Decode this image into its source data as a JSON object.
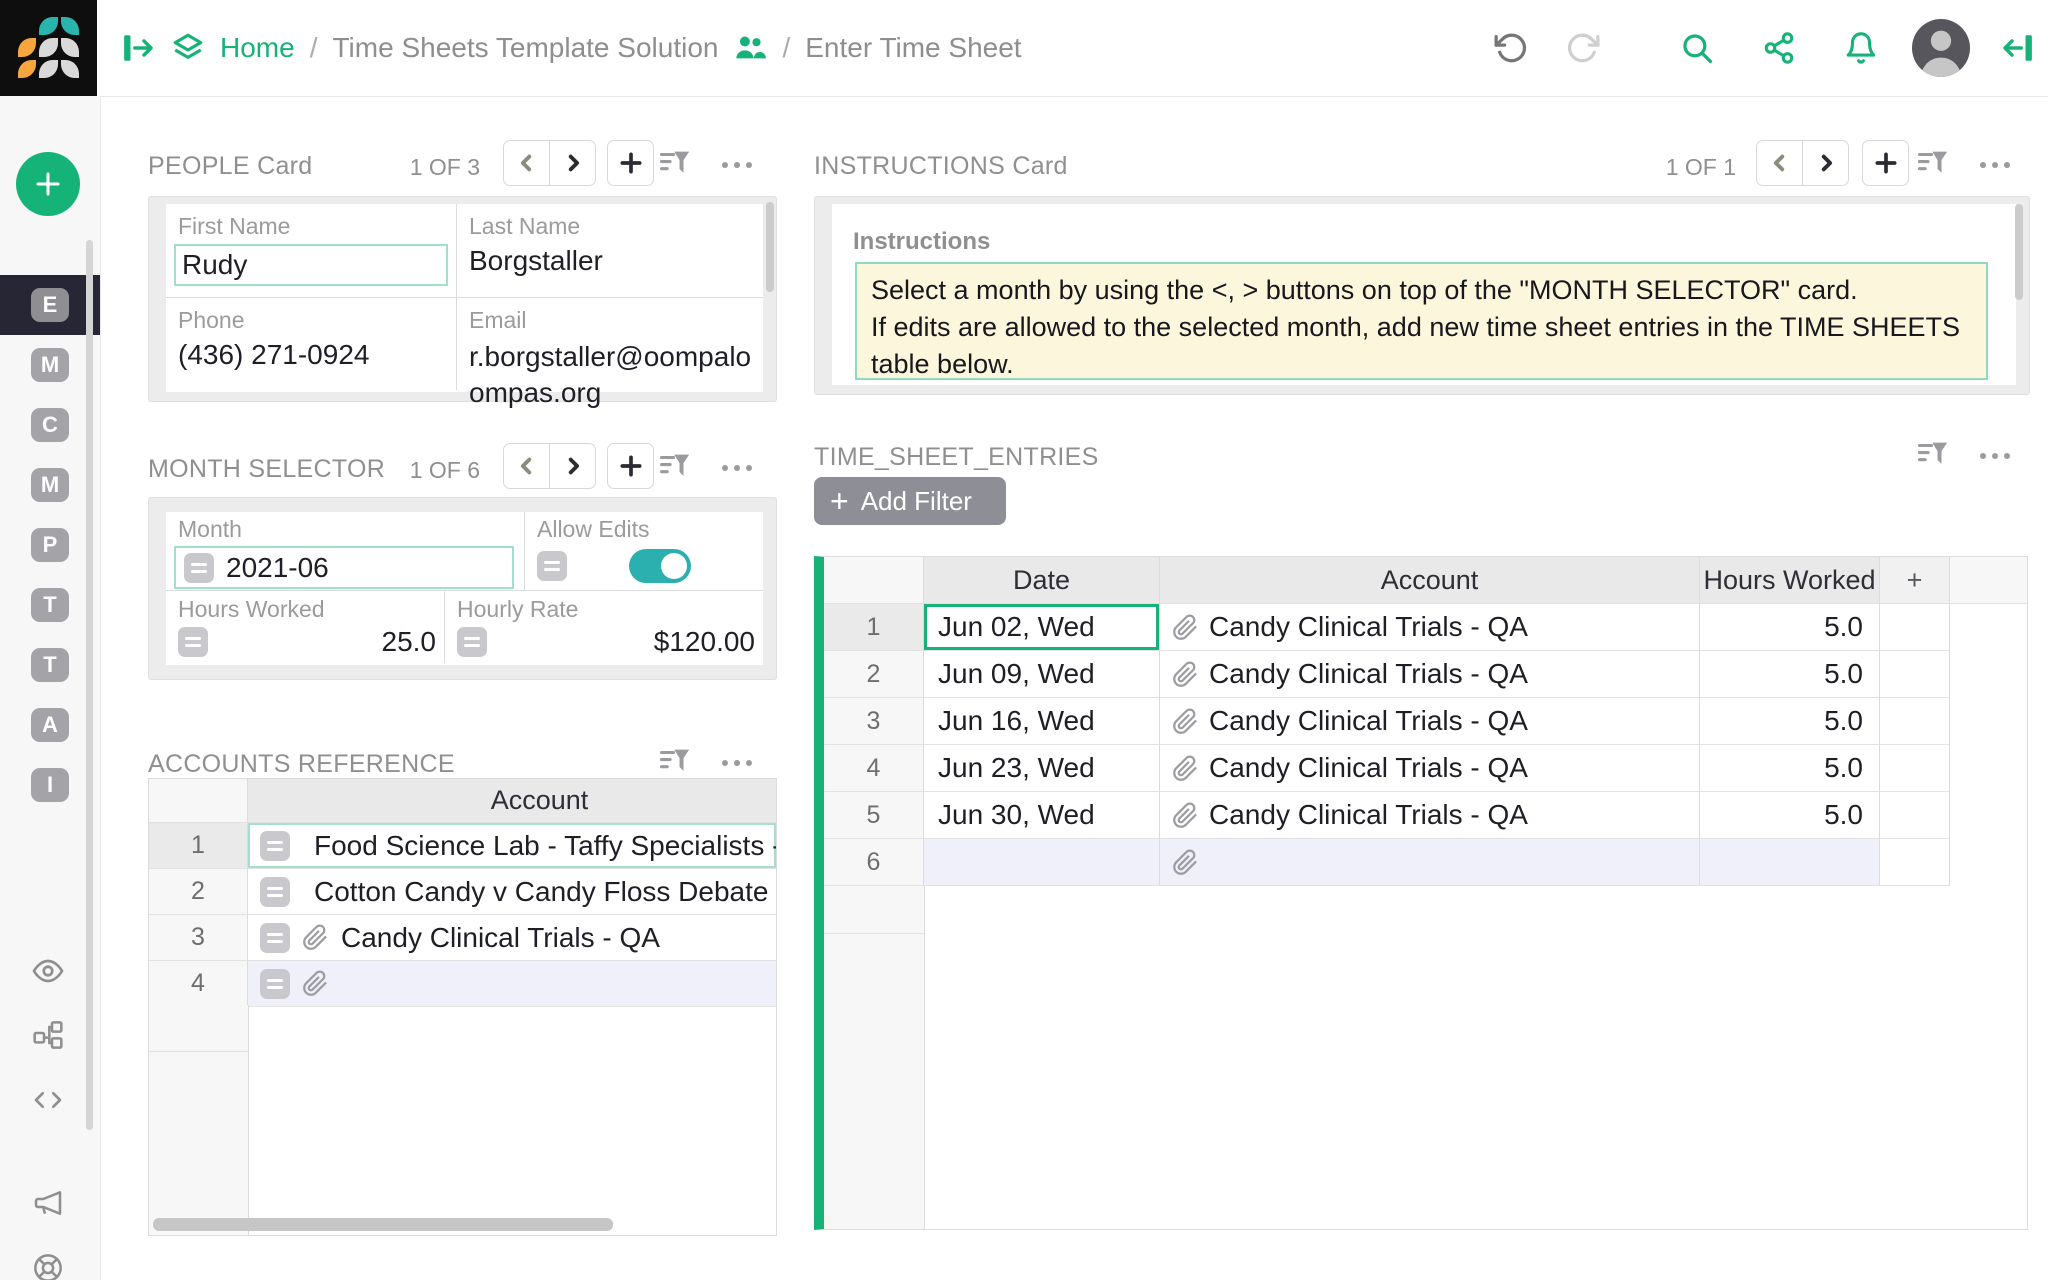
{
  "topbar": {
    "breadcrumb": {
      "home": "Home",
      "sep1": "/",
      "workspace": "Time Sheets Template Solution",
      "sep2": "/",
      "page": "Enter Time Sheet"
    }
  },
  "sidebar": {
    "pages": [
      "E",
      "M",
      "C",
      "M",
      "P",
      "T",
      "T",
      "A",
      "I"
    ]
  },
  "people_card": {
    "title": "PEOPLE Card",
    "count": "1 OF 3",
    "fields": {
      "first_name": {
        "label": "First Name",
        "value": "Rudy"
      },
      "last_name": {
        "label": "Last Name",
        "value": "Borgstaller"
      },
      "phone": {
        "label": "Phone",
        "value": "(436) 271-0924"
      },
      "email": {
        "label": "Email",
        "value": "r.borgstaller@oompaloompas.org"
      }
    }
  },
  "month_selector": {
    "title": "MONTH SELECTOR",
    "count": "1 OF 6",
    "month": {
      "label": "Month",
      "value": "2021-06"
    },
    "allow_edits": {
      "label": "Allow Edits",
      "enabled": true
    },
    "hours_worked": {
      "label": "Hours Worked",
      "value": "25.0"
    },
    "hourly_rate": {
      "label": "Hourly Rate",
      "value": "$120.00"
    }
  },
  "accounts_reference": {
    "title": "ACCOUNTS REFERENCE",
    "column_header": "Account",
    "rows": [
      {
        "num": "1",
        "account": "Food Science Lab - Taffy Specialists -"
      },
      {
        "num": "2",
        "account": "Cotton Candy v Candy Floss Debate T"
      },
      {
        "num": "3",
        "account": "Candy Clinical Trials - QA"
      },
      {
        "num": "4",
        "account": ""
      }
    ]
  },
  "instructions_card": {
    "title": "INSTRUCTIONS Card",
    "count": "1 OF 1",
    "field_label": "Instructions",
    "lines": [
      "Select a month by using the <, > buttons on top of the \"MONTH SELECTOR\" card.",
      "If edits are allowed to the selected month, add new time sheet entries in the TIME SHEETS",
      "table below."
    ]
  },
  "time_sheet": {
    "title": "TIME_SHEET_ENTRIES",
    "add_filter_label": "Add Filter",
    "headers": {
      "date": "Date",
      "account": "Account",
      "hours": "Hours Worked",
      "add_column": "+"
    },
    "rows": [
      {
        "num": "1",
        "date": "Jun 02, Wed",
        "account": "Candy Clinical Trials - QA",
        "hours": "5.0"
      },
      {
        "num": "2",
        "date": "Jun 09, Wed",
        "account": "Candy Clinical Trials - QA",
        "hours": "5.0"
      },
      {
        "num": "3",
        "date": "Jun 16, Wed",
        "account": "Candy Clinical Trials - QA",
        "hours": "5.0"
      },
      {
        "num": "4",
        "date": "Jun 23, Wed",
        "account": "Candy Clinical Trials - QA",
        "hours": "5.0"
      },
      {
        "num": "5",
        "date": "Jun 30, Wed",
        "account": "Candy Clinical Trials - QA",
        "hours": "5.0"
      },
      {
        "num": "6",
        "date": "",
        "account": "",
        "hours": ""
      }
    ]
  },
  "colors": {
    "accent_green": "#16B378",
    "toggle_teal": "#2CB0AF",
    "selection_mint": "#A3E0C8",
    "instructions_yellow": "#FBF6DC",
    "new_row_lavender": "#F0F0FA",
    "sidebar_active": "#262634"
  }
}
